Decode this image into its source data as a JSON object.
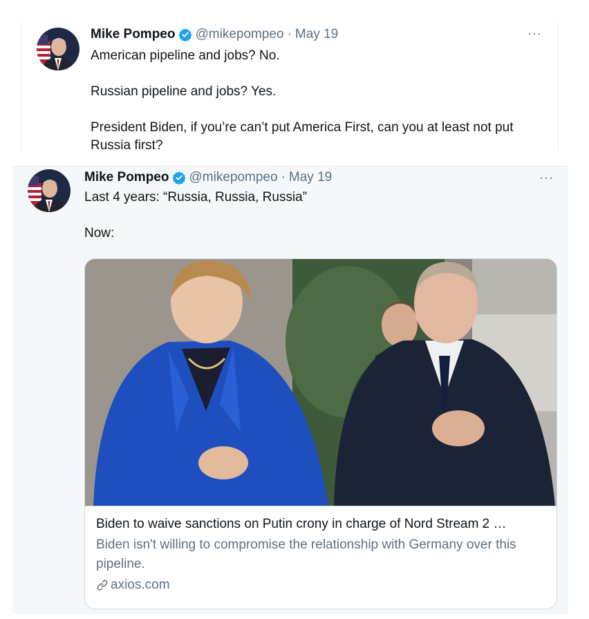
{
  "tweets": [
    {
      "author_name": "Mike Pompeo",
      "handle": "@mikepompeo",
      "separator": "·",
      "date": "May 19",
      "more_label": "···",
      "lines": [
        "American pipeline and jobs? No.",
        "Russian pipeline and jobs? Yes.",
        "President Biden, if you’re can’t put America First, can you at least not put Russia first?"
      ]
    },
    {
      "author_name": "Mike Pompeo",
      "handle": "@mikepompeo",
      "separator": "·",
      "date": "May 19",
      "more_label": "···",
      "lines": [
        "Last 4 years: “Russia, Russia, Russia”",
        "Now:"
      ],
      "card": {
        "title": "Biden to waive sanctions on Putin crony in charge of Nord Stream 2 …",
        "description": "Biden isn't willing to compromise the relationship with Germany over this pipeline.",
        "domain": "axios.com"
      }
    }
  ],
  "icons": {
    "verified": "verified-badge-icon",
    "more": "more-options-icon",
    "link": "link-icon"
  },
  "colors": {
    "accent": "#1da1f2",
    "secondary_text": "#5b7083",
    "primary_text": "#0f1419",
    "highlight_bg": "#f5f8fa"
  }
}
